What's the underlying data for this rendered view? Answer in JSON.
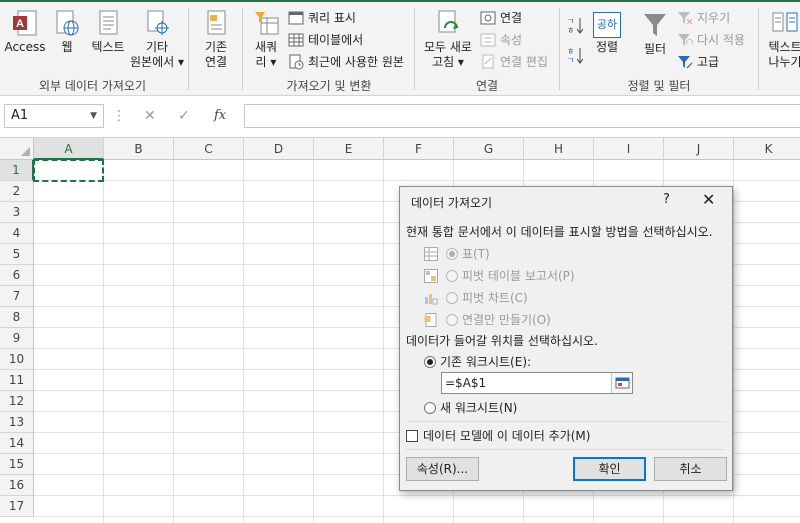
{
  "ribbon": {
    "get_external": {
      "group_label": "외부 데이터 가져오기",
      "access": "Access",
      "web": "웹",
      "text": "텍스트",
      "other_line1": "기타",
      "other_line2": "원본에서 ▾"
    },
    "existing": {
      "line1": "기존",
      "line2": "연결"
    },
    "get_transform": {
      "group_label": "가져오기 및 변환",
      "new_query_line1": "새쿼",
      "new_query_line2": "리 ▾",
      "show_queries": "쿼리 표시",
      "from_table": "테이블에서",
      "recent_sources": "최근에 사용한 원본"
    },
    "connections": {
      "group_label": "연결",
      "refresh_line1": "모두 새로",
      "refresh_line2": "고침 ▾",
      "connections": "연결",
      "properties": "속성",
      "edit_links": "연결 편집"
    },
    "sort_filter": {
      "group_label": "정렬 및 필터",
      "sort": "정렬",
      "sort_custom_glyph": "공하",
      "filter": "필터",
      "clear": "지우기",
      "reapply": "다시 적용",
      "advanced": "고급"
    },
    "data_tools": {
      "line1": "텍스트",
      "line2": "나누기"
    }
  },
  "formula_bar": {
    "name_box": "A1",
    "cancel": "✕",
    "enter": "✓",
    "fx": "fx",
    "formula": ""
  },
  "grid": {
    "columns": [
      "A",
      "B",
      "C",
      "D",
      "E",
      "F",
      "G",
      "H",
      "I",
      "J",
      "K"
    ],
    "rows": [
      "1",
      "2",
      "3",
      "4",
      "5",
      "6",
      "7",
      "8",
      "9",
      "10",
      "11",
      "12",
      "13",
      "14",
      "15",
      "16",
      "17"
    ],
    "active_cell": "A1"
  },
  "dialog": {
    "title": "데이터 가져오기",
    "help": "?",
    "close": "✕",
    "view_prompt": "현재 통합 문서에서 이 데이터를 표시할 방법을 선택하십시오.",
    "options": [
      {
        "label": "표(T)",
        "selected": true,
        "disabled": true,
        "icon": "table-icon"
      },
      {
        "label": "피벗 테이블 보고서(P)",
        "selected": false,
        "disabled": true,
        "icon": "pivot-table-icon"
      },
      {
        "label": "피벗 차트(C)",
        "selected": false,
        "disabled": true,
        "icon": "pivot-chart-icon"
      },
      {
        "label": "연결만 만들기(O)",
        "selected": false,
        "disabled": true,
        "icon": "connection-only-icon"
      }
    ],
    "location_prompt": "데이터가 들어갈 위치를 선택하십시오.",
    "existing_sheet": "기존 워크시트(E):",
    "existing_selected": true,
    "reference": "=$A$1",
    "new_sheet": "새 워크시트(N)",
    "add_to_model": "데이터 모델에 이 데이터 추가(M)",
    "add_to_model_checked": false,
    "properties_button": "속성(R)...",
    "ok_button": "확인",
    "cancel_button": "취소"
  },
  "colors": {
    "accent": "#217346",
    "focus": "#0078d7",
    "access_red": "#a4373a"
  }
}
